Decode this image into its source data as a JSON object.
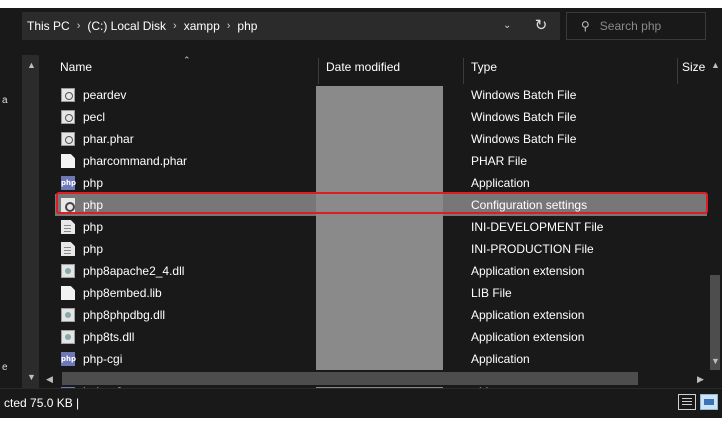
{
  "address_bar": {
    "segments": [
      "This PC",
      "(C:) Local Disk",
      "xampp",
      "php"
    ],
    "separator": "›"
  },
  "search": {
    "placeholder": "Search php",
    "icon": "search-icon"
  },
  "columns": {
    "name": "Name",
    "date_modified": "Date modified",
    "type": "Type",
    "size": "Size"
  },
  "files": [
    {
      "name": "peardev",
      "type": "Windows Batch File",
      "icon": "batch-file-icon"
    },
    {
      "name": "pecl",
      "type": "Windows Batch File",
      "icon": "batch-file-icon"
    },
    {
      "name": "phar.phar",
      "type": "Windows Batch File",
      "icon": "batch-file-icon"
    },
    {
      "name": "pharcommand.phar",
      "type": "PHAR File",
      "icon": "file-icon"
    },
    {
      "name": "php",
      "type": "Application",
      "icon": "php-app-icon"
    },
    {
      "name": "php",
      "type": "Configuration settings",
      "icon": "config-file-icon",
      "selected": true
    },
    {
      "name": "php",
      "type": "INI-DEVELOPMENT File",
      "icon": "ini-file-icon"
    },
    {
      "name": "php",
      "type": "INI-PRODUCTION File",
      "icon": "ini-file-icon"
    },
    {
      "name": "php8apache2_4.dll",
      "type": "Application extension",
      "icon": "dll-file-icon"
    },
    {
      "name": "php8embed.lib",
      "type": "LIB File",
      "icon": "file-icon"
    },
    {
      "name": "php8phpdbg.dll",
      "type": "Application extension",
      "icon": "dll-file-icon"
    },
    {
      "name": "php8ts.dll",
      "type": "Application extension",
      "icon": "dll-file-icon"
    },
    {
      "name": "php-cgi",
      "type": "Application",
      "icon": "php-app-icon"
    },
    {
      "name": "phpdbg",
      "type": "Application",
      "icon": "php-app-icon"
    }
  ],
  "status_bar": {
    "text": "cted  75.0 KB  |"
  },
  "colors": {
    "background": "#191919",
    "selection": "#777777",
    "highlight_box": "#e01b24",
    "redaction": "#8a8a8a"
  }
}
